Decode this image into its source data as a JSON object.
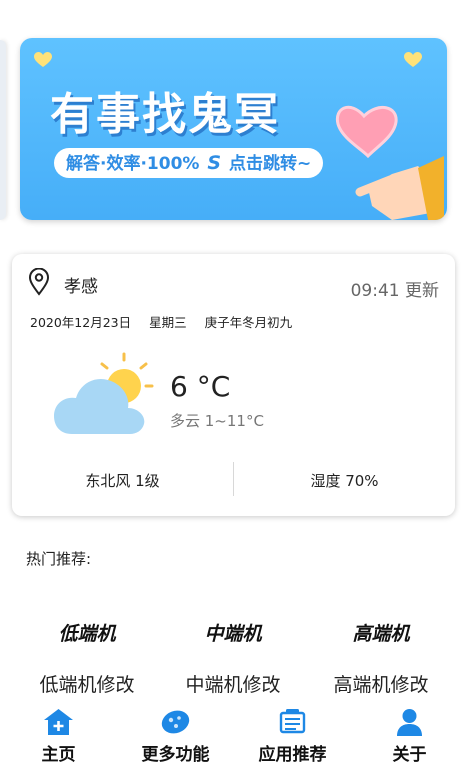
{
  "banner": {
    "title": "有事找鬼冥",
    "subtitle": "解答·效率·100%",
    "cta": "点击跳转~",
    "s_mark": "S"
  },
  "weather": {
    "city": "孝感",
    "update_time": "09:41 更新",
    "date": "2020年12月23日",
    "weekday": "星期三",
    "lunar": "庚子年冬月初九",
    "temperature": "6 °C",
    "condition": "多云 1~11°C",
    "wind": "东北风 1级",
    "humidity": "湿度 70%",
    "icon": "partly-cloudy-icon"
  },
  "hot": {
    "label": "热门推荐:",
    "items": [
      {
        "logo": "低端机",
        "name": "低端机修改"
      },
      {
        "logo": "中端机",
        "name": "中端机修改"
      },
      {
        "logo": "高端机",
        "name": "高端机修改"
      }
    ]
  },
  "nav": {
    "items": [
      {
        "label": "主页",
        "icon": "home-icon"
      },
      {
        "label": "更多功能",
        "icon": "more-features-icon"
      },
      {
        "label": "应用推荐",
        "icon": "app-recommend-icon"
      },
      {
        "label": "关于",
        "icon": "user-icon"
      }
    ]
  },
  "colors": {
    "banner_blue": "#46aef8",
    "nav_blue": "#1e88e5"
  }
}
